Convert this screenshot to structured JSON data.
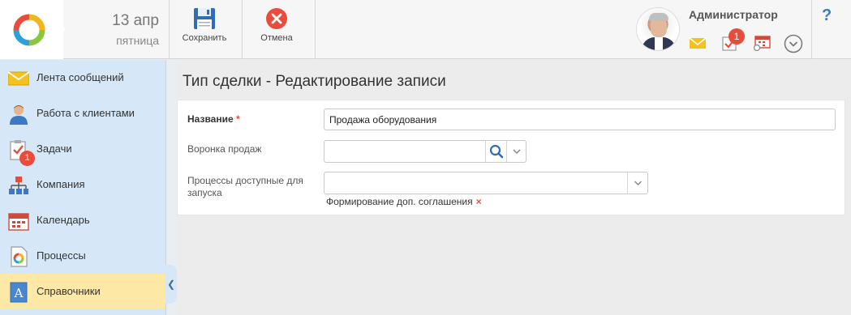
{
  "header": {
    "date_day": "13 апр",
    "date_weekday": "пятница",
    "save_label": "Сохранить",
    "cancel_label": "Отмена",
    "user_name": "Администратор",
    "tasks_count": "1",
    "help": "?"
  },
  "sidebar": {
    "items": [
      {
        "label": "Лента сообщений",
        "icon": "mail-icon"
      },
      {
        "label": "Работа с клиентами",
        "icon": "client-icon"
      },
      {
        "label": "Задачи",
        "icon": "tasks-icon",
        "badge": "1"
      },
      {
        "label": "Компания",
        "icon": "org-chart-icon"
      },
      {
        "label": "Календарь",
        "icon": "calendar-icon"
      },
      {
        "label": "Процессы",
        "icon": "process-icon"
      },
      {
        "label": "Справочники",
        "icon": "directory-icon",
        "active": true
      }
    ]
  },
  "main": {
    "title": "Тип сделки - Редактирование записи",
    "form": {
      "name_label": "Название",
      "required_mark": "*",
      "name_value": "Продажа оборудования",
      "funnel_label": "Воронка продаж",
      "funnel_value": "",
      "processes_label_line1": "Процессы доступные для",
      "processes_label_line2": "запуска",
      "processes_value": "",
      "processes_tag": "Формирование доп. соглашения",
      "tag_remove": "×"
    }
  },
  "colors": {
    "accent_blue": "#3b7dc4",
    "badge_red": "#e74c3c",
    "sidebar_bg": "#d6e7f7",
    "active_item": "#fde8a6"
  }
}
